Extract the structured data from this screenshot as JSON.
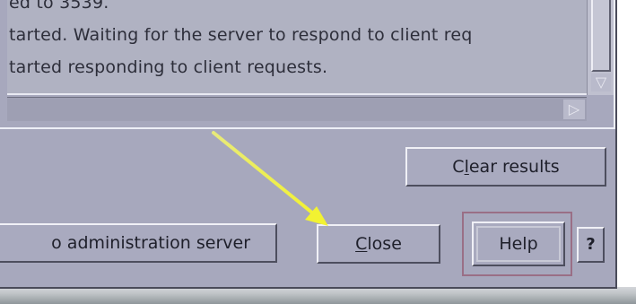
{
  "results": {
    "lines": [
      "ed to 3539.",
      "tarted. Waiting for the server to respond to client req",
      "tarted responding to client requests."
    ]
  },
  "buttons": {
    "clear_results": {
      "label_pre": "C",
      "label_u": "l",
      "label_post": "ear results"
    },
    "admin_server": {
      "label": "o administration server"
    },
    "close": {
      "label_u": "C",
      "label_post": "lose"
    },
    "help": {
      "label": "Help"
    },
    "question": {
      "label": "?"
    }
  },
  "icons": {
    "vscroll_down": "triangle-down",
    "hscroll_right": "triangle-right",
    "annotation": "yellow-arrow"
  },
  "colors": {
    "dialog_bg": "#a7a8bd",
    "annotation_arrow": "#f2f24a",
    "help_focus_frame": "#9a6f86"
  }
}
